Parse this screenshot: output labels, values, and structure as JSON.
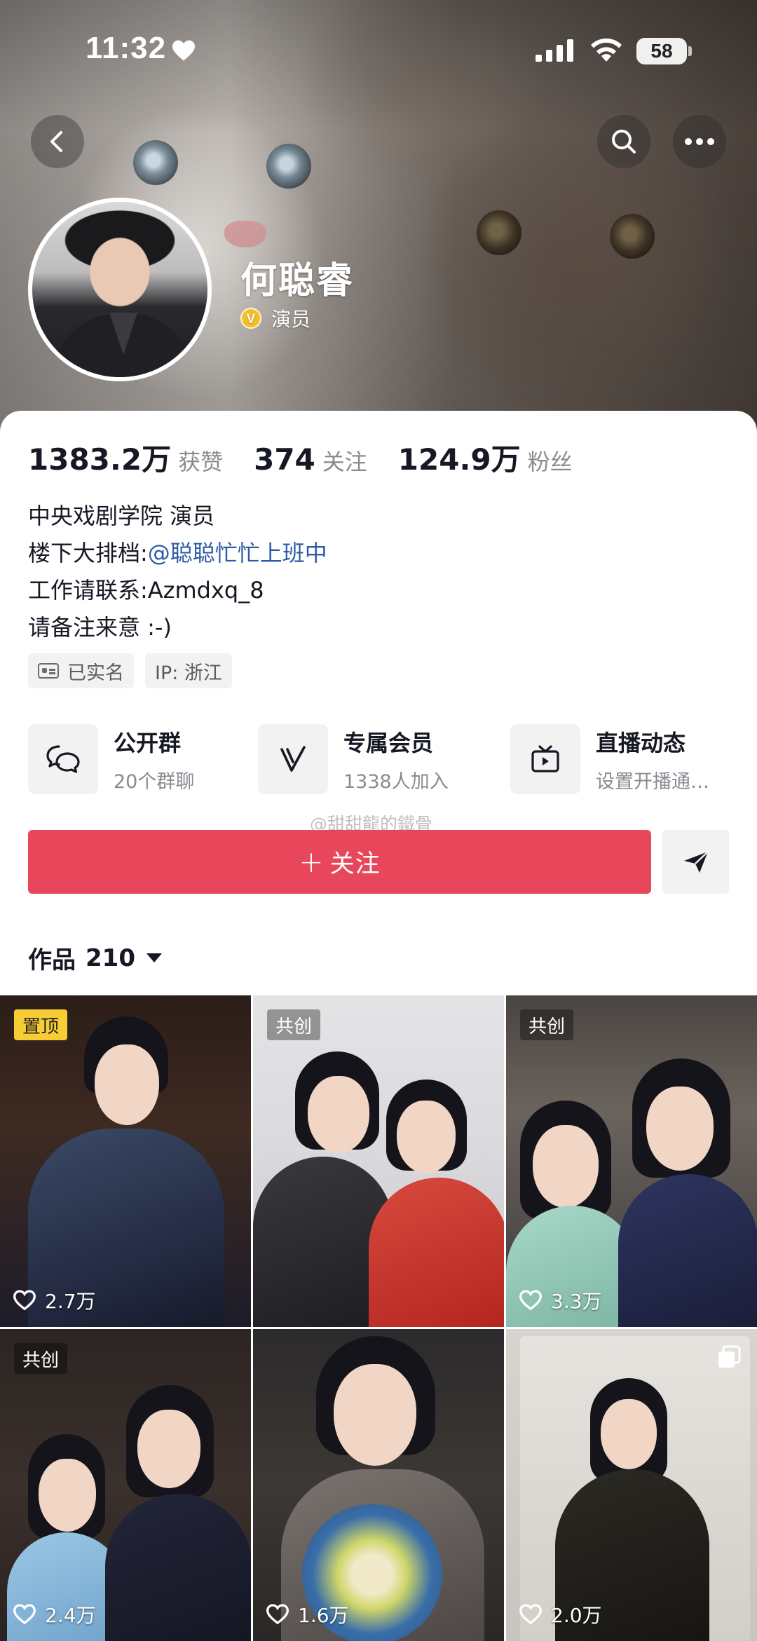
{
  "status_bar": {
    "time": "11:32",
    "battery": "58"
  },
  "profile": {
    "name": "何聪睿",
    "verification": "演员",
    "verify_badge": "V"
  },
  "stats": [
    {
      "value": "1383.2万",
      "label": "获赞"
    },
    {
      "value": "374",
      "label": "关注"
    },
    {
      "value": "124.9万",
      "label": "粉丝"
    }
  ],
  "bio": {
    "line1": "中央戏剧学院 演员",
    "line2_prefix": "楼下大排档:",
    "line2_mention": "@聪聪忙忙上班中",
    "line3": "工作请联系:Azmdxq_8",
    "line4": "请备注来意 :-)"
  },
  "tags": {
    "verified": "已实名",
    "ip": "IP:  浙江"
  },
  "entries": [
    {
      "title": "公开群",
      "subtitle": "20个群聊",
      "icon": "chat-bubbles-icon"
    },
    {
      "title": "专属会员",
      "subtitle": "1338人加入",
      "icon": "member-v-icon"
    },
    {
      "title": "直播动态",
      "subtitle": "设置开播通…",
      "icon": "live-tv-icon"
    }
  ],
  "watermark": "@甜甜龍的鐵骨",
  "actions": {
    "follow_plus": "+",
    "follow_label": "关注"
  },
  "works": {
    "label": "作品",
    "count": "210"
  },
  "videos": [
    {
      "badge": "置顶",
      "likes": "2.7万"
    },
    {
      "badge": "共创",
      "likes": ""
    },
    {
      "badge": "共创",
      "likes": "3.3万"
    },
    {
      "badge": "共创",
      "likes": "2.4万"
    },
    {
      "badge": "",
      "likes": "1.6万"
    },
    {
      "badge": "",
      "likes": "2.0万"
    }
  ],
  "colors": {
    "follow_red": "#e8465a",
    "pinned_yellow": "#f6cd34",
    "mention_blue": "#2e5aa6",
    "verify_gold": "#f4c026"
  }
}
